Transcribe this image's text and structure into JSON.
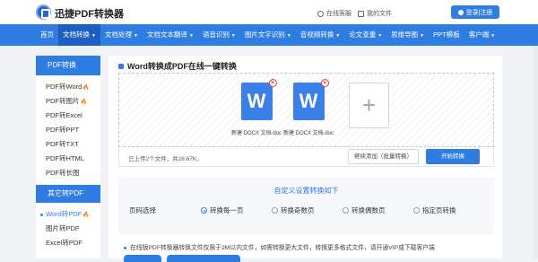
{
  "header": {
    "brand": "迅捷PDF转换器",
    "online_help": "在线客服",
    "my_files": "我的文件",
    "login": "登录|注册"
  },
  "nav": {
    "items": [
      {
        "label": "首页",
        "caret": false
      },
      {
        "label": "文档转换",
        "caret": true,
        "active": true
      },
      {
        "label": "文档处理",
        "caret": true
      },
      {
        "label": "文档文本翻译",
        "caret": true
      },
      {
        "label": "语音识别",
        "caret": true
      },
      {
        "label": "图片文字识别",
        "caret": true
      },
      {
        "label": "音视频转换",
        "caret": true
      },
      {
        "label": "论文查重",
        "caret": true
      },
      {
        "label": "思维导图",
        "caret": true
      },
      {
        "label": "PPT模板",
        "caret": false
      },
      {
        "label": "客户端",
        "caret": true
      }
    ]
  },
  "sidebar": {
    "group1_title": "PDF转换",
    "group1": [
      {
        "label": "PDF转Word",
        "hot": true
      },
      {
        "label": "PDF转图片",
        "hot": true
      },
      {
        "label": "PDF转Excel"
      },
      {
        "label": "PDF转PPT"
      },
      {
        "label": "PDF转TXT"
      },
      {
        "label": "PDF转HTML"
      },
      {
        "label": "PDF转长图"
      }
    ],
    "group2_title": "其它转PDF",
    "group2": [
      {
        "label": "Word转PDF",
        "hot": true,
        "current": true
      },
      {
        "label": "图片转PDF"
      },
      {
        "label": "Excel转PDF"
      }
    ]
  },
  "main": {
    "title": "Word转换成PDF在线一键转换",
    "files": [
      {
        "name": "新建 DOCX 文档.docx",
        "icon_letter": "W"
      },
      {
        "name": "新建 DOCX 文档.docx",
        "icon_letter": "W"
      }
    ],
    "add_icon": "+",
    "count_text": "已上传2个文件，共28.67K。",
    "continue_btn": "继续添加（批量转换）",
    "start_btn": "开始转换",
    "settings_title": "自定义设置转换如下",
    "page_select_label": "页码选择",
    "options": [
      {
        "label": "转换每一页",
        "checked": true
      },
      {
        "label": "转换奇数页"
      },
      {
        "label": "转换偶数页"
      },
      {
        "label": "指定页转换"
      }
    ],
    "note": "在线版PDF转换器转换文件仅限于2M以内文件，如需转换更大文件，转换更多格式文件，请开通VIP或下载客户端"
  },
  "colors": {
    "primary": "#2f7de1",
    "fire": "#f25a1a"
  }
}
